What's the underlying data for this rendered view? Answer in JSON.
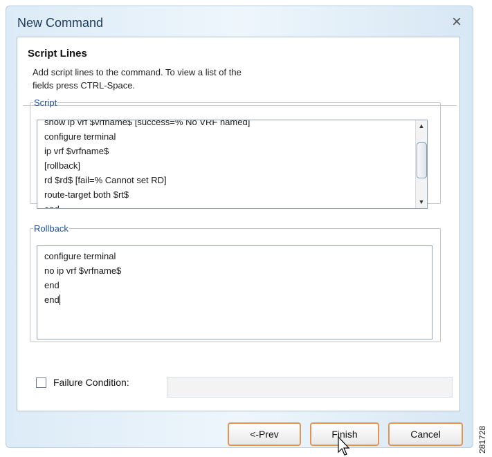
{
  "window": {
    "title": "New Command",
    "close_label": "×"
  },
  "section": {
    "title": "Script Lines",
    "description_line1": "Add script lines to the command. To view a list of the",
    "description_line2": "fields press CTRL-Space."
  },
  "script": {
    "legend": "Script",
    "cutoff_line": "show ip vrf $vrfname$ [success=% No VRF named]",
    "lines": [
      "configure terminal",
      "ip vrf $vrfname$",
      "[rollback]",
      "rd $rd$ [fail=% Cannot set RD]",
      "route-target both $rt$",
      "end"
    ],
    "scroll_up_icon": "▲",
    "scroll_down_icon": "▼"
  },
  "rollback": {
    "legend": "Rollback",
    "lines": [
      "configure terminal",
      "no ip vrf $vrfname$",
      "end",
      "end"
    ]
  },
  "failure": {
    "label": "Failure Condition:",
    "checked": false,
    "value": ""
  },
  "buttons": {
    "prev": "<-Prev",
    "finish": "Finish",
    "cancel": "Cancel"
  },
  "figure_number": "281728",
  "colors": {
    "title_text": "#1e3a5c",
    "legend_text": "#1e4f9a",
    "button_border": "#e39450"
  }
}
